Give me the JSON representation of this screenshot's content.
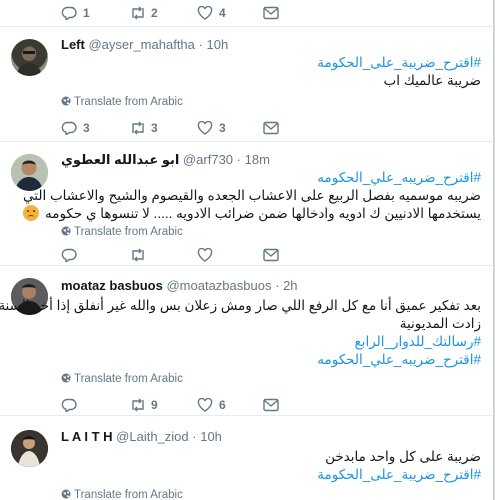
{
  "tweets": [
    {
      "actions": {
        "reply": "1",
        "retweet": "2",
        "like": "4"
      }
    },
    {
      "name": "Left",
      "handle": "@ayser_mahaftha",
      "separator": "·",
      "time": "10h",
      "hashtag": "#اقترح_ضريبة_على_الحكومة",
      "text": "ضريبة عالميك اب",
      "translate": "Translate from Arabic",
      "actions": {
        "reply": "3",
        "retweet": "3",
        "like": "3"
      }
    },
    {
      "name": "ابو عبدالله العطوي",
      "handle": "@arf730",
      "separator": "·",
      "time": "18m",
      "hashtag": "#اقترح_ضريبه_علي_الحكومه",
      "line1": "ضريبه موسميه بفصل الربيع على الاعشاب الجعده والقيصوم والشيح والاعشاب التي",
      "line2": "يستخدمها الادنيين ك ادويه وادخالها ضمن ضرائب الادويه ..... لا تنسوها ي حكومه",
      "translate": "Translate from Arabic",
      "actions": {
        "reply": "",
        "retweet": "",
        "like": ""
      }
    },
    {
      "name": "moataz basbuos",
      "handle": "@moatazbasbuos",
      "separator": "·",
      "time": "2h",
      "line1": "بعد تفكير عميق أنا مع كل الرفع اللي صار ومش زعلان بس والله غير أنفلق إذا أخر السنة",
      "line2": "زادت المديونية",
      "hashtag1": "#رسالتك_للدوار_الرابع",
      "hashtag2": "#اقترح_ضريبه_علي_الحكومه",
      "translate": "Translate from Arabic",
      "actions": {
        "reply": "",
        "retweet": "9",
        "like": "6"
      }
    },
    {
      "name": "L A I T H",
      "handle": "@Laith_ziod",
      "separator": "·",
      "time": "10h",
      "text": "ضريبة على كل واحد مابدخن",
      "hashtag": "#اقترح_ضريبة_على_الحكومة",
      "translate": "Translate from Arabic"
    }
  ],
  "colors": {
    "link": "#1b95e0",
    "muted": "#657786",
    "text": "#14171a",
    "divider": "#e6ecf0"
  },
  "icons": [
    "reply-icon",
    "retweet-icon",
    "like-icon",
    "message-icon",
    "globe-icon",
    "sad-face-emoji"
  ]
}
